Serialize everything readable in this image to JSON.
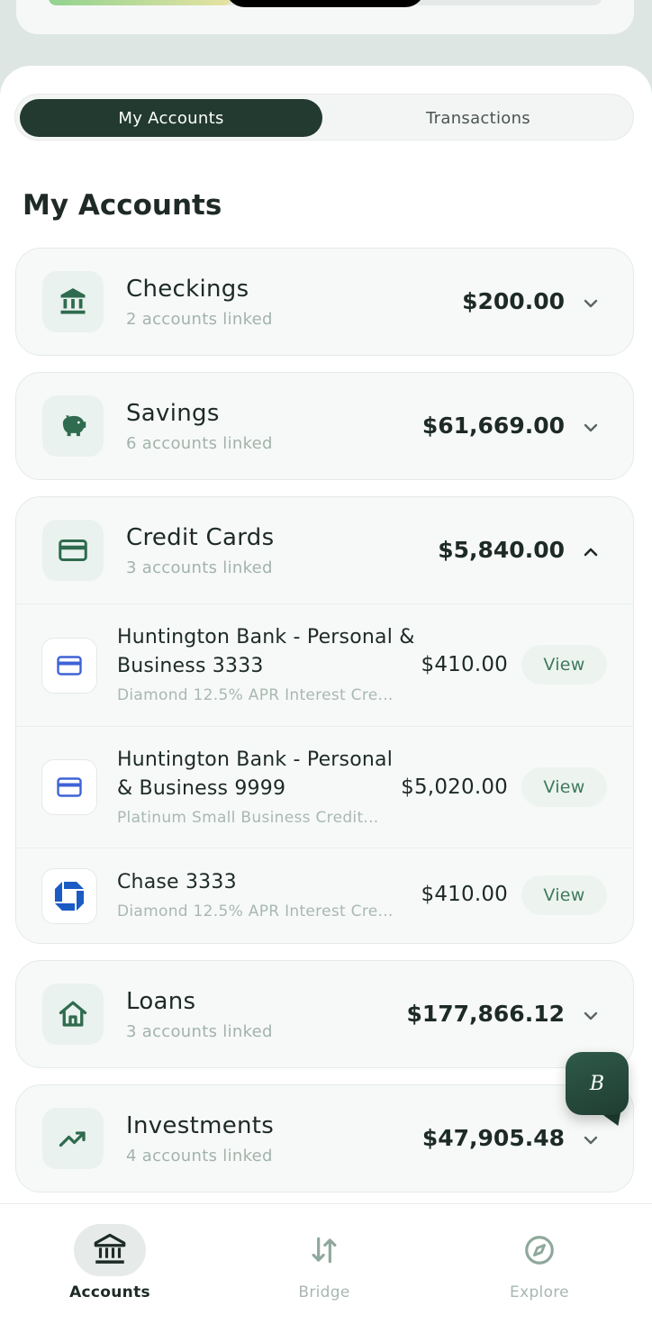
{
  "top_card": {
    "progress_fraction": 0.33
  },
  "tabs": [
    {
      "label": "My Accounts",
      "active": true
    },
    {
      "label": "Transactions",
      "active": false
    }
  ],
  "section_title": "My Accounts",
  "categories": {
    "checkings": {
      "name": "Checkings",
      "sub": "2 accounts linked",
      "amount": "$200.00",
      "icon": "bank-icon",
      "expanded": false
    },
    "savings": {
      "name": "Savings",
      "sub": "6 accounts linked",
      "amount": "$61,669.00",
      "icon": "piggy-bank-icon",
      "expanded": false
    },
    "credit_cards": {
      "name": "Credit Cards",
      "sub": "3 accounts linked",
      "amount": "$5,840.00",
      "icon": "credit-card-icon",
      "expanded": true,
      "accounts": [
        {
          "name": "Huntington Bank - Personal & Business 3333",
          "desc": "Diamond 12.5% APR Interest Cre...",
          "amount": "$410.00",
          "action": "View",
          "logo": "card-logo-icon"
        },
        {
          "name": "Huntington Bank - Personal & Business 9999",
          "desc": "Platinum Small Business Credit...",
          "amount": "$5,020.00",
          "action": "View",
          "logo": "card-logo-icon"
        },
        {
          "name": "Chase 3333",
          "desc": "Diamond 12.5% APR Interest Cre...",
          "amount": "$410.00",
          "action": "View",
          "logo": "chase-logo-icon"
        }
      ]
    },
    "loans": {
      "name": "Loans",
      "sub": "3 accounts linked",
      "amount": "$177,866.12",
      "icon": "home-icon",
      "expanded": false
    },
    "investments": {
      "name": "Investments",
      "sub": "4 accounts linked",
      "amount": "$47,905.48",
      "icon": "trending-up-icon",
      "expanded": false
    }
  },
  "assistant_button": {
    "label": "B"
  },
  "bottom_nav": [
    {
      "label": "Accounts",
      "icon": "bank-icon",
      "active": true
    },
    {
      "label": "Bridge",
      "icon": "transfer-arrows-icon",
      "active": false
    },
    {
      "label": "Explore",
      "icon": "compass-icon",
      "active": false
    }
  ],
  "colors": {
    "primary_dark": "#223a30",
    "accent_green": "#3f7a5d",
    "icon_bg": "#e9f2ee",
    "muted_text": "#a2b3ab"
  }
}
